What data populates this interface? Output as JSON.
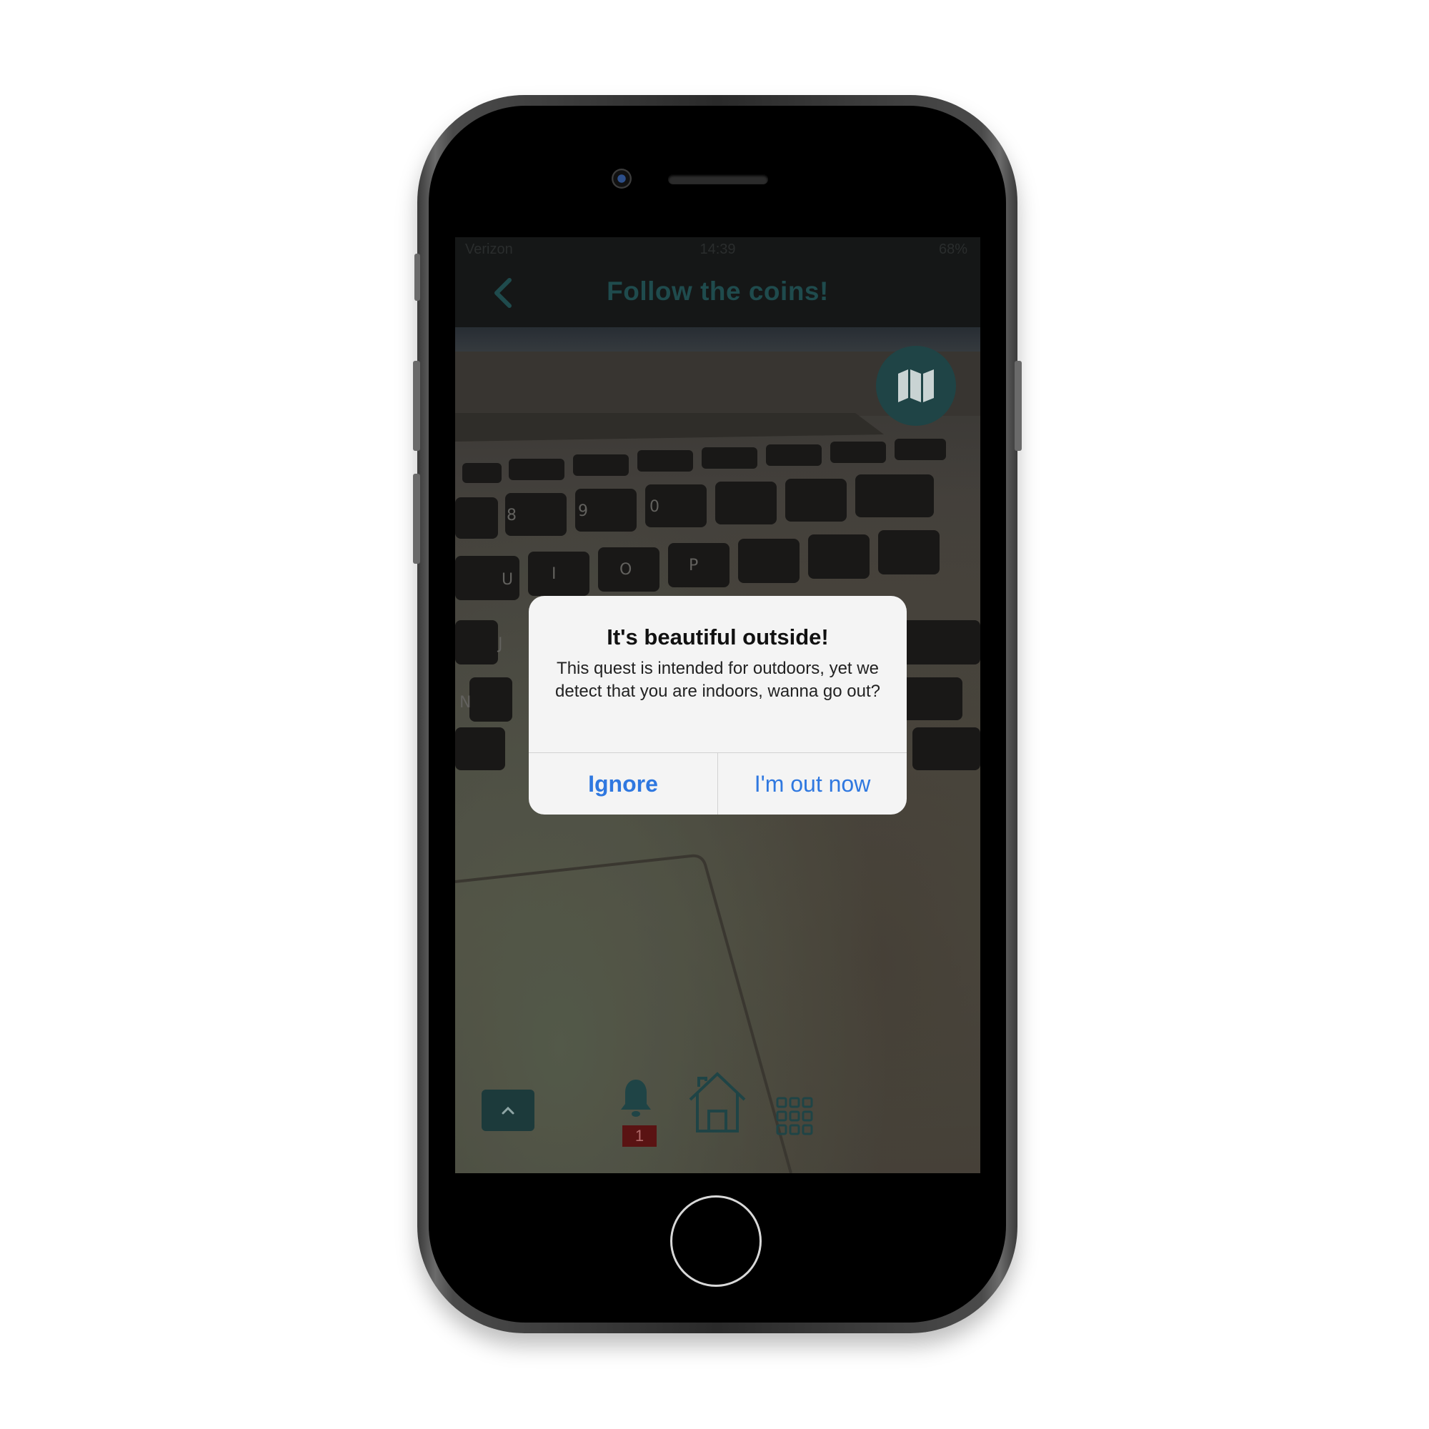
{
  "status_bar": {
    "carrier": "Verizon",
    "time": "14:39",
    "battery": "68%"
  },
  "nav": {
    "title": "Follow the coins!",
    "back_icon": "chevron-left-icon"
  },
  "map_button": {
    "icon": "map-icon"
  },
  "alert": {
    "title": "It's beautiful outside!",
    "message": "This quest is intended for outdoors, yet we detect that you are indoors, wanna go out?",
    "buttons": {
      "ignore": "Ignore",
      "out_now": "I'm out now"
    }
  },
  "bottom_bar": {
    "up_icon": "chevron-up-icon",
    "notifications_icon": "bell-icon",
    "notifications_count": "1",
    "home_icon": "house-icon",
    "menu_icon": "grid-icon"
  },
  "colors": {
    "accent": "#1f4b4d",
    "alert_button": "#2f78e0",
    "badge": "#5a1313"
  }
}
